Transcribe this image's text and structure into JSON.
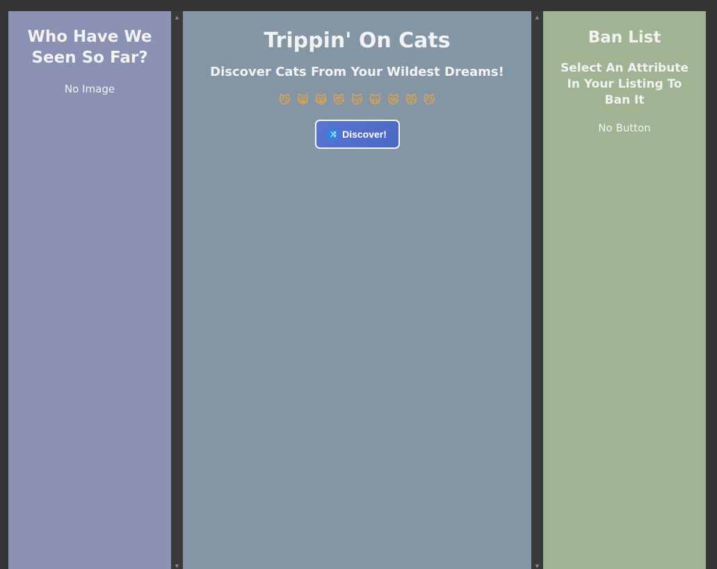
{
  "left_panel": {
    "title": "Who Have We Seen So Far?",
    "empty_text": "No Image",
    "bg": "#8b91b3"
  },
  "center_panel": {
    "title": "Trippin' On Cats",
    "subtitle": "Discover Cats From Your Wildest Dreams!",
    "emojis": [
      "😼",
      "😸",
      "😹",
      "😻",
      "😽",
      "🙀",
      "😿",
      "😾",
      "😼"
    ],
    "discover_button": {
      "label": "Discover!",
      "icon": "shuffle-icon"
    },
    "bg": "#8496a5"
  },
  "right_panel": {
    "title": "Ban List",
    "subtitle": "Select An Attribute In Your Listing To Ban It",
    "empty_text": "No Button",
    "bg": "#a0b392"
  },
  "colors": {
    "background": "#333333",
    "button_bg": "#5877cf",
    "text": "#f2f2f2"
  }
}
